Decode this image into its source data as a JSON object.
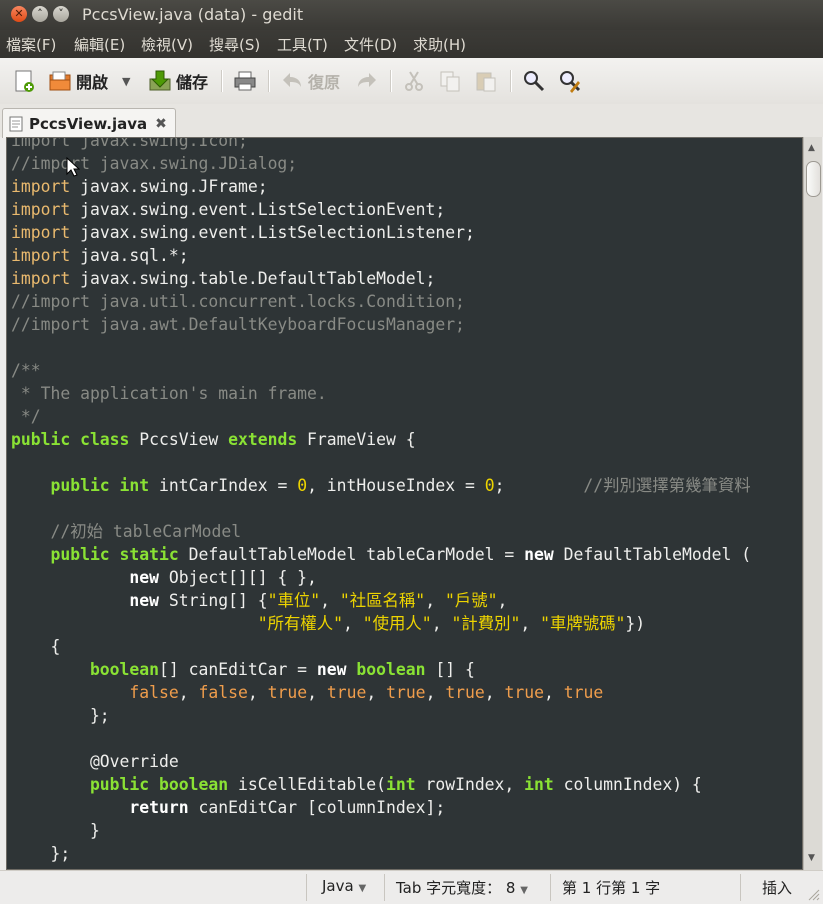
{
  "window": {
    "title": "PccsView.java (data) - gedit"
  },
  "menu": [
    "檔案(F)",
    "編輯(E)",
    "檢視(V)",
    "搜尋(S)",
    "工具(T)",
    "文件(D)",
    "求助(H)"
  ],
  "toolbar": {
    "open_label": "開啟",
    "save_label": "儲存",
    "undo_label": "復原"
  },
  "tab": {
    "label": "PccsView.java"
  },
  "statusbar": {
    "language": "Java",
    "tab_width": "Tab 字元寬度： 8",
    "position": "第 1 行第 1 字",
    "mode": "插入"
  },
  "code": {
    "l0": "import javax.swing.Icon;",
    "l1": "//import javax.swing.JDialog;",
    "l2a": "import",
    "l2b": " javax.swing.JFrame;",
    "l3a": "import",
    "l3b": " javax.swing.event.ListSelectionEvent;",
    "l4a": "import",
    "l4b": " javax.swing.event.ListSelectionListener;",
    "l5a": "import",
    "l5b": " java.sql.*;",
    "l6a": "import",
    "l6b": " javax.swing.table.DefaultTableModel;",
    "l7": "//import java.util.concurrent.locks.Condition;",
    "l8": "//import java.awt.DefaultKeyboardFocusManager;",
    "l10": "/**",
    "l11": " * The application's main frame.",
    "l12": " */",
    "l13a": "public class",
    "l13b": " PccsView ",
    "l13c": "extends",
    "l13d": " FrameView {",
    "l15a": "    public int",
    "l15b": " intCarIndex = ",
    "l15c": "0",
    "l15d": ", intHouseIndex = ",
    "l15e": "0",
    "l15f": ";        ",
    "l15g": "//判別選擇第幾筆資料",
    "l17": "    //初始 tableCarModel",
    "l18a": "    public static",
    "l18b": " DefaultTableModel tableCarModel = ",
    "l18c": "new",
    "l18d": " DefaultTableModel (",
    "l19a": "            new",
    "l19b": " Object[][] { },",
    "l20a": "            new",
    "l20b": " String[] {",
    "l20c": "\"車位\"",
    "l20d": ", ",
    "l20e": "\"社區名稱\"",
    "l20f": ", ",
    "l20g": "\"戶號\"",
    "l20h": ",",
    "l21a": "                         ",
    "l21b": "\"所有權人\"",
    "l21c": ", ",
    "l21d": "\"使用人\"",
    "l21e": ", ",
    "l21f": "\"計費別\"",
    "l21g": ", ",
    "l21h": "\"車牌號碼\"",
    "l21i": "})",
    "l22": "    {",
    "l23a": "        boolean",
    "l23b": "[] canEditCar = ",
    "l23c": "new",
    "l23d": " ",
    "l23e": "boolean",
    "l23f": " [] {",
    "l24a": "            ",
    "l24b": "false",
    "l24c": ", ",
    "l24d": "false",
    "l24e": ", ",
    "l24f": "true",
    "l24g": ", ",
    "l24h": "true",
    "l24i": ", ",
    "l24j": "true",
    "l24k": ", ",
    "l24l": "true",
    "l24m": ", ",
    "l24n": "true",
    "l24o": ", ",
    "l24p": "true",
    "l25": "        };",
    "l27": "        @Override",
    "l28a": "        public boolean",
    "l28b": " isCellEditable(",
    "l28c": "int",
    "l28d": " rowIndex, ",
    "l28e": "int",
    "l28f": " columnIndex) {",
    "l29a": "            return",
    "l29b": " canEditCar [columnIndex];",
    "l30": "        }",
    "l31": "    };"
  }
}
